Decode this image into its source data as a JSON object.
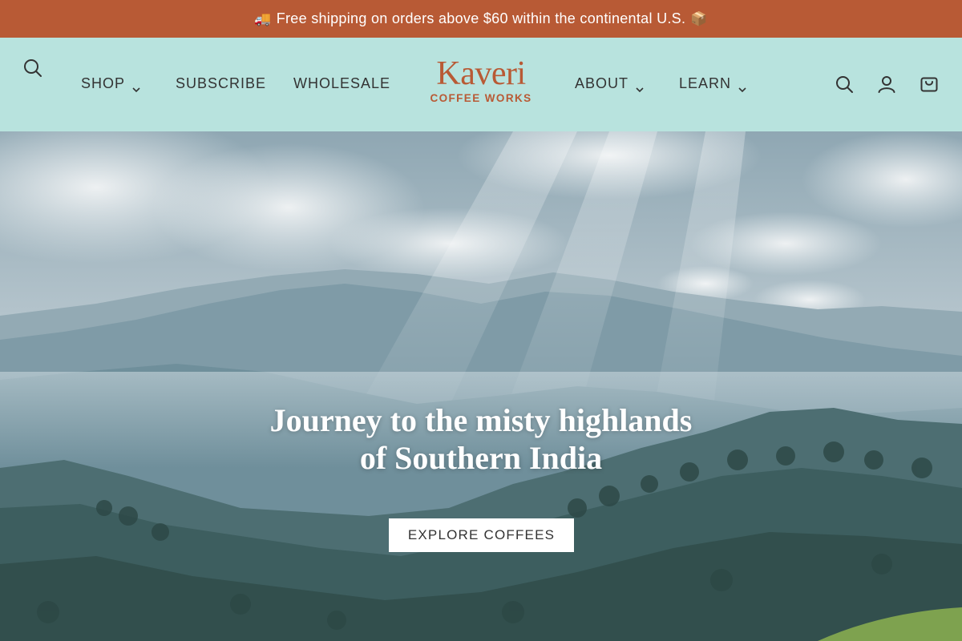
{
  "colors": {
    "announce_bg": "#b85a35",
    "header_bg": "#b8e3de",
    "brand": "#b85a35",
    "nav_text": "#333333",
    "hero_text": "#ffffff",
    "cta_bg": "#ffffff"
  },
  "announcement": {
    "emoji_left": "🚚",
    "text": "Free shipping on orders above $60 within the continental U.S.",
    "emoji_right": "📦"
  },
  "header": {
    "left_search_icon": "search-icon",
    "nav_left": [
      {
        "label": "SHOP",
        "has_dropdown": true
      },
      {
        "label": "SUBSCRIBE",
        "has_dropdown": false
      },
      {
        "label": "WHOLESALE",
        "has_dropdown": false
      }
    ],
    "logo": {
      "name": "Kaveri",
      "tagline": "COFFEE WORKS"
    },
    "nav_right": [
      {
        "label": "ABOUT",
        "has_dropdown": true
      },
      {
        "label": "LEARN",
        "has_dropdown": true
      }
    ],
    "icons": [
      "search-icon",
      "account-icon",
      "cart-icon"
    ]
  },
  "hero": {
    "title_line1": "Journey to the misty highlands",
    "title_line2": "of Southern India",
    "cta_label": "EXPLORE COFFEES"
  }
}
